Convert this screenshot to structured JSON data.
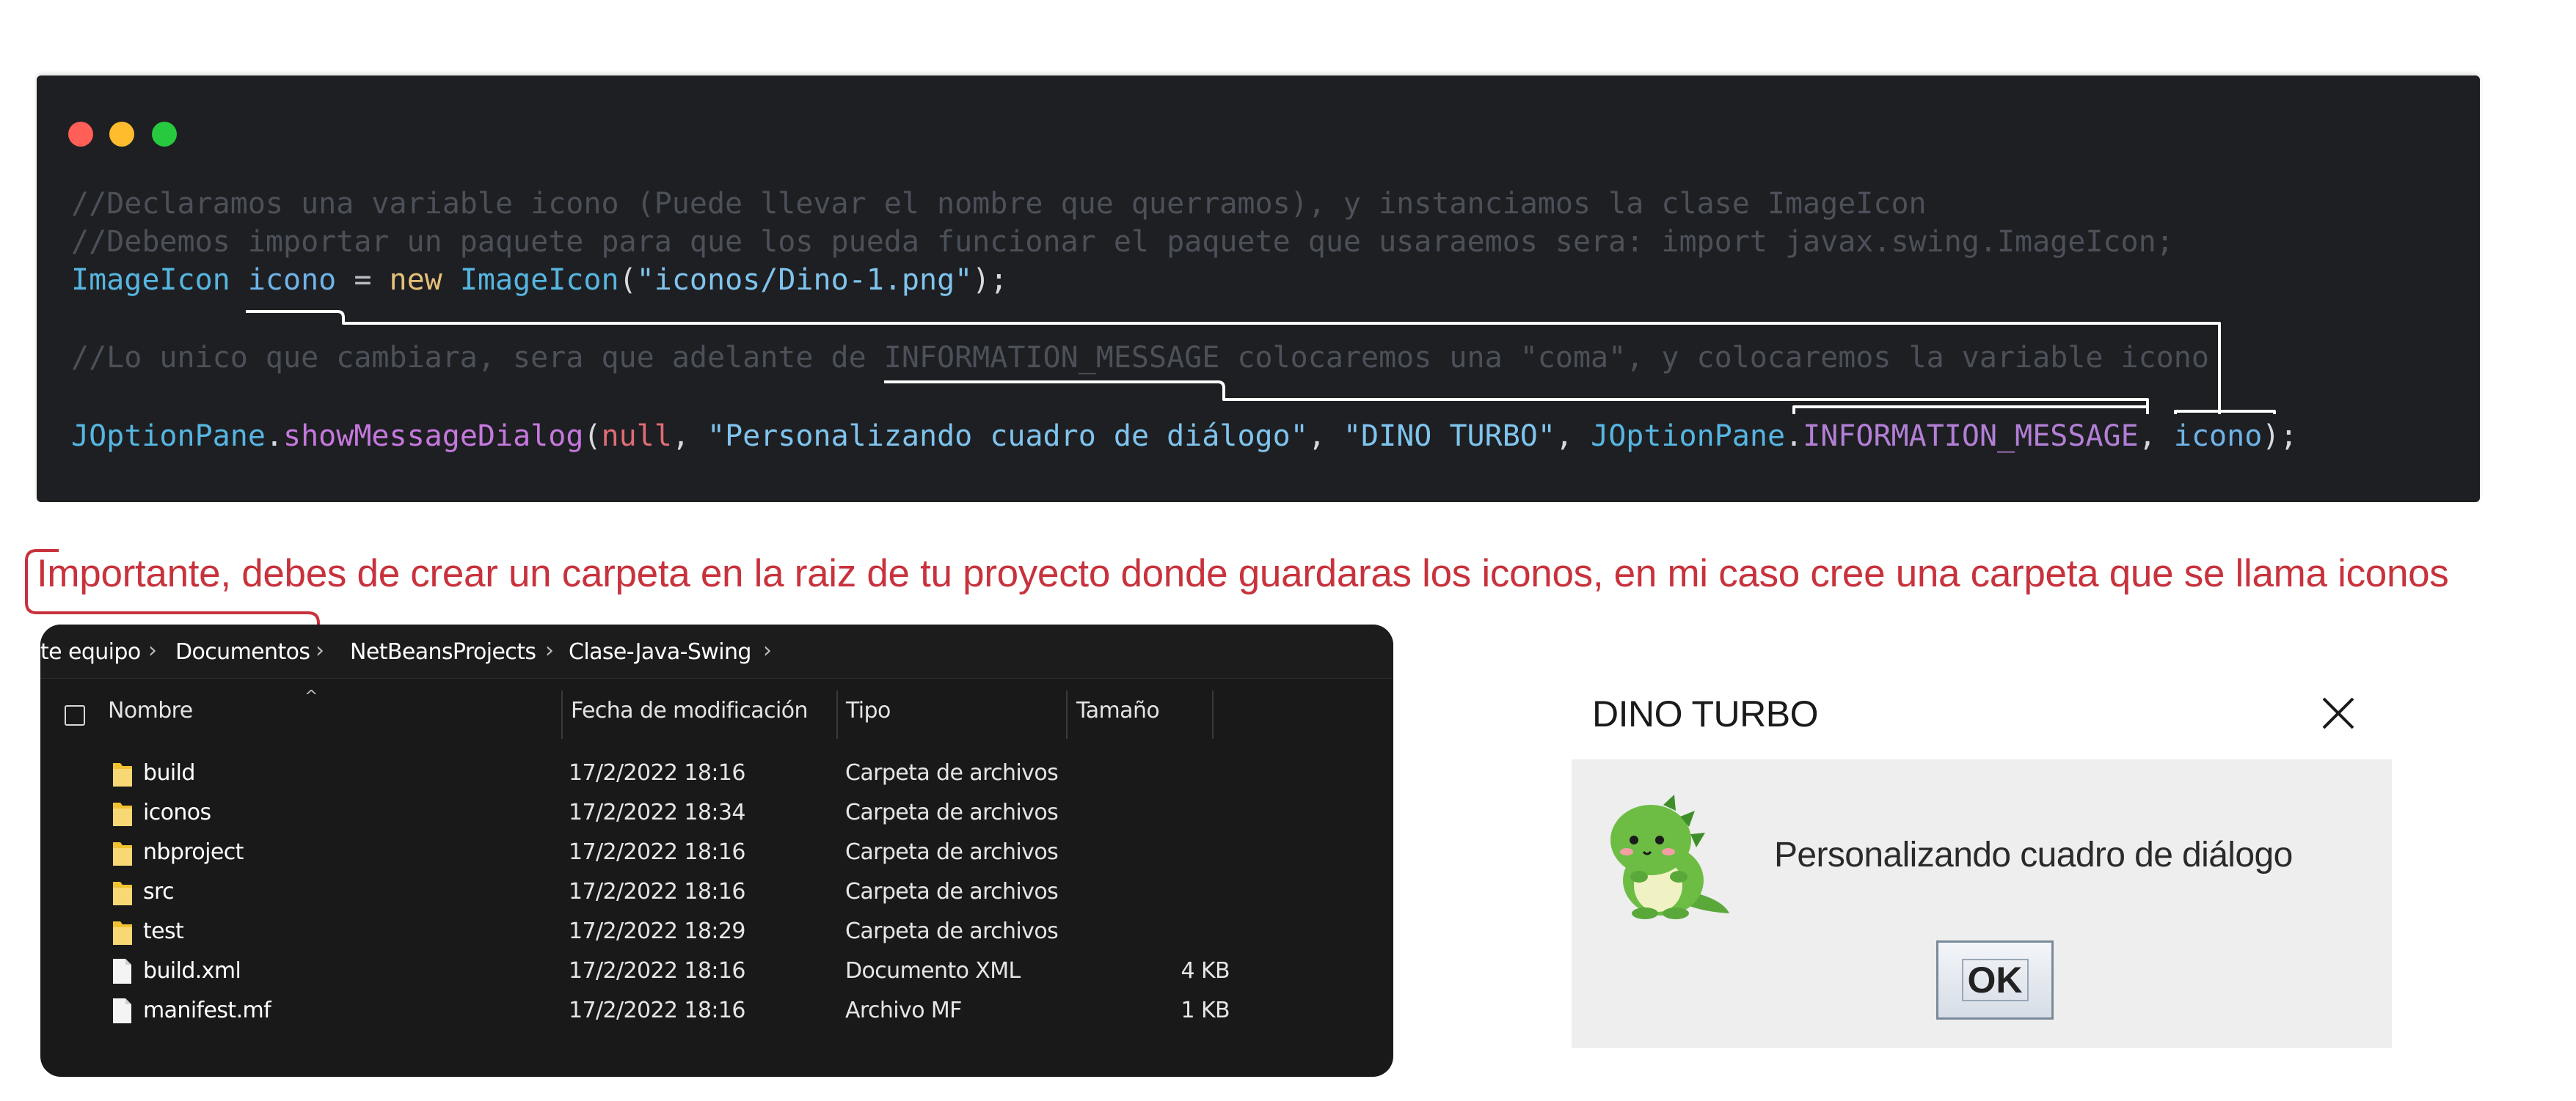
{
  "code": {
    "line1": "//Declaramos una variable icono (Puede llevar el nombre que querramos), y instanciamos la clase ImageIcon",
    "line2": "//Debemos importar un paquete para que los pueda funcionar el paquete que usaraemos sera: import javax.swing.ImageIcon;",
    "line3": {
      "t1": "ImageIcon",
      "t2": " icono",
      "t3": " = ",
      "t4": "new",
      "t5": " ImageIcon",
      "t6": "(",
      "t7": "\"iconos/Dino-1.png\"",
      "t8": ");"
    },
    "line4": "//Lo unico que cambiara, sera que adelante de INFORMATION_MESSAGE colocaremos una \"coma\", y colocaremos la variable icono",
    "line5": {
      "t1": "JOptionPane",
      "t2": ".",
      "t3": "showMessageDialog",
      "t4": "(",
      "t5": "null",
      "t6": ", ",
      "t7": "\"Personalizando cuadro de diálogo\"",
      "t8": ", ",
      "t9": "\"DINO TURBO\"",
      "t10": ", ",
      "t11": "JOptionPane",
      "t12": ".",
      "t13": "INFORMATION_MESSAGE",
      "t14": ", ",
      "t15": "icono",
      "t16": ");"
    }
  },
  "note": "Importante, debes de crear un carpeta en la raiz de tu proyecto donde guardaras los iconos, en mi caso cree una carpeta que se llama iconos",
  "explorer": {
    "breadcrumb": [
      "te equipo",
      "Documentos",
      "NetBeansProjects",
      "Clase-Java-Swing"
    ],
    "columns": {
      "name": "Nombre",
      "date": "Fecha de modificación",
      "type": "Tipo",
      "size": "Tamaño"
    },
    "rows": [
      {
        "name": "build",
        "date": "17/2/2022 18:16",
        "type": "Carpeta de archivos",
        "size": "",
        "icon": "folder-icon"
      },
      {
        "name": "iconos",
        "date": "17/2/2022 18:34",
        "type": "Carpeta de archivos",
        "size": "",
        "icon": "folder-icon"
      },
      {
        "name": "nbproject",
        "date": "17/2/2022 18:16",
        "type": "Carpeta de archivos",
        "size": "",
        "icon": "folder-icon"
      },
      {
        "name": "src",
        "date": "17/2/2022 18:16",
        "type": "Carpeta de archivos",
        "size": "",
        "icon": "folder-icon"
      },
      {
        "name": "test",
        "date": "17/2/2022 18:29",
        "type": "Carpeta de archivos",
        "size": "",
        "icon": "folder-icon"
      },
      {
        "name": "build.xml",
        "date": "17/2/2022 18:16",
        "type": "Documento XML",
        "size": "4 KB",
        "icon": "file-icon"
      },
      {
        "name": "manifest.mf",
        "date": "17/2/2022 18:16",
        "type": "Archivo MF",
        "size": "1 KB",
        "icon": "file-icon"
      }
    ]
  },
  "dialog": {
    "title": "DINO TURBO",
    "message": "Personalizando cuadro de diálogo",
    "ok_label": "OK",
    "icon": "dino-icon"
  },
  "colors": {
    "code_bg": "#1e1f22",
    "annotation_red": "#c8323c",
    "explorer_bg": "#191919",
    "dialog_body": "#eeeeee"
  }
}
